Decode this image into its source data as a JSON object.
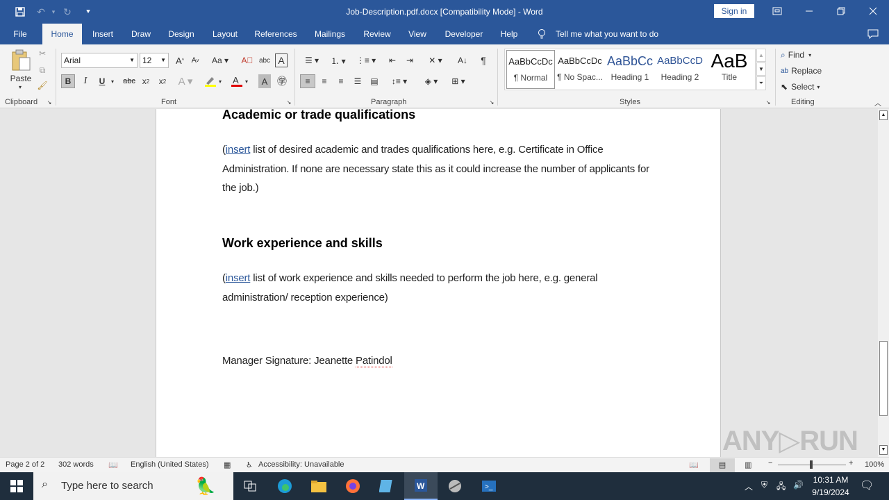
{
  "titlebar": {
    "title": "Job-Description.pdf.docx [Compatibility Mode]  -  Word",
    "sign_in": "Sign in",
    "save_icon": "save-icon",
    "undo_icon": "undo-icon",
    "redo_icon": "redo-icon",
    "customize_icon": "customize-qat-icon"
  },
  "tabs": [
    "File",
    "Home",
    "Insert",
    "Draw",
    "Design",
    "Layout",
    "References",
    "Mailings",
    "Review",
    "View",
    "Developer",
    "Help"
  ],
  "tell_me": "Tell me what you want to do",
  "ribbon": {
    "clipboard": {
      "label": "Clipboard",
      "paste": "Paste"
    },
    "font": {
      "label": "Font",
      "name": "Arial",
      "size": "12"
    },
    "paragraph": {
      "label": "Paragraph"
    },
    "styles": {
      "label": "Styles",
      "items": [
        {
          "preview": "AaBbCcDc",
          "name": "¶ Normal"
        },
        {
          "preview": "AaBbCcDc",
          "name": "¶ No Spac..."
        },
        {
          "preview": "AaBbCc",
          "name": "Heading 1"
        },
        {
          "preview": "AaBbCcD",
          "name": "Heading 2"
        },
        {
          "preview": "AaB",
          "name": "Title"
        }
      ]
    },
    "editing": {
      "label": "Editing",
      "find": "Find",
      "replace": "Replace",
      "select": "Select"
    }
  },
  "document": {
    "heading1": "Academic or trade qualifications",
    "para1_insert": "insert",
    "para1_open": "(",
    "para1_rest": " list of desired academic and trades qualifications here, e.g. Certificate in Office Administration. If none are necessary state this as it could increase the number of applicants for the job.)",
    "heading2": "Work experience and skills",
    "para2_open": "(",
    "para2_insert": "insert",
    "para2_rest": " list of work experience and skills needed to perform the job here, e.g. general administration/ reception experience)",
    "signature_label": "Manager Signature: Jeanette ",
    "signature_name": "Patindol"
  },
  "status": {
    "page": "Page 2 of 2",
    "words": "302 words",
    "language": "English (United States)",
    "accessibility": "Accessibility: Unavailable",
    "zoom": "100%"
  },
  "taskbar": {
    "search_placeholder": "Type here to search",
    "time": "10:31 AM",
    "date": "9/19/2024"
  },
  "colors": {
    "word_blue": "#2b579a",
    "taskbar": "#1f2e3d"
  }
}
